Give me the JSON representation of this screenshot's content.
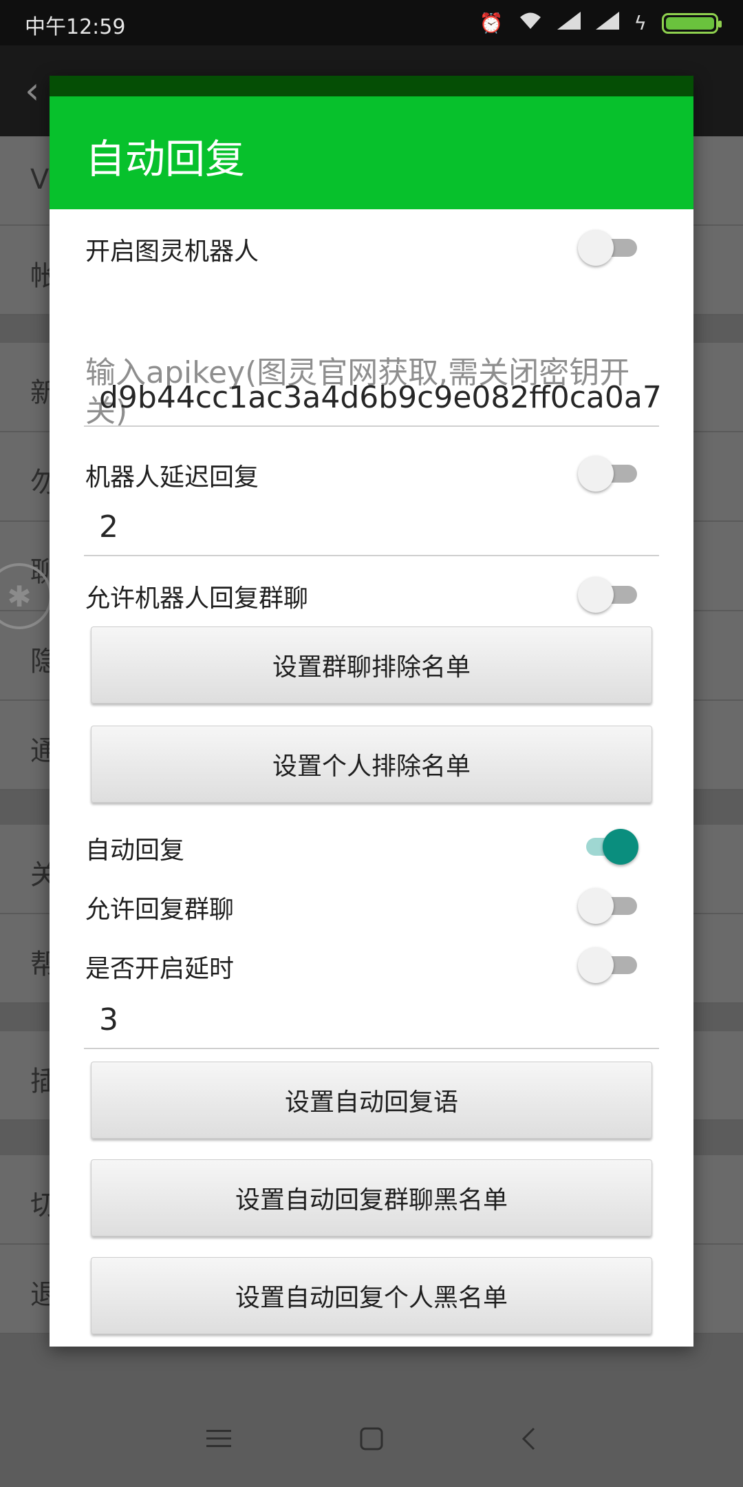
{
  "status_bar": {
    "time": "中午12:59"
  },
  "background_app": {
    "rows": [
      "V",
      "帐",
      "新",
      "勿",
      "聊",
      "隐",
      "通",
      "关",
      "帮",
      "插",
      "切",
      "退出"
    ]
  },
  "dialog": {
    "title": "自动回复",
    "robot_toggle": {
      "label": "开启图灵机器人",
      "on": false
    },
    "apikey_hint": "输入apikey(图灵官网获取,需关闭密钥开关)",
    "apikey_value": "d9b44cc1ac3a4d6b9c9e082ff0ca0a7",
    "robot_delay": {
      "label": "机器人延迟回复",
      "on": false,
      "value": "2"
    },
    "robot_group": {
      "label": "允许机器人回复群聊",
      "on": false
    },
    "btn_group_exclude": "设置群聊排除名单",
    "btn_person_exclude": "设置个人排除名单",
    "auto_reply": {
      "label": "自动回复",
      "on": true
    },
    "allow_group": {
      "label": "允许回复群聊",
      "on": false
    },
    "delay": {
      "label": "是否开启延时",
      "on": false,
      "value": "3"
    },
    "btn_reply_text": "设置自动回复语",
    "btn_group_blacklist": "设置自动回复群聊黑名单",
    "btn_person_blacklist": "设置自动回复个人黑名单"
  }
}
